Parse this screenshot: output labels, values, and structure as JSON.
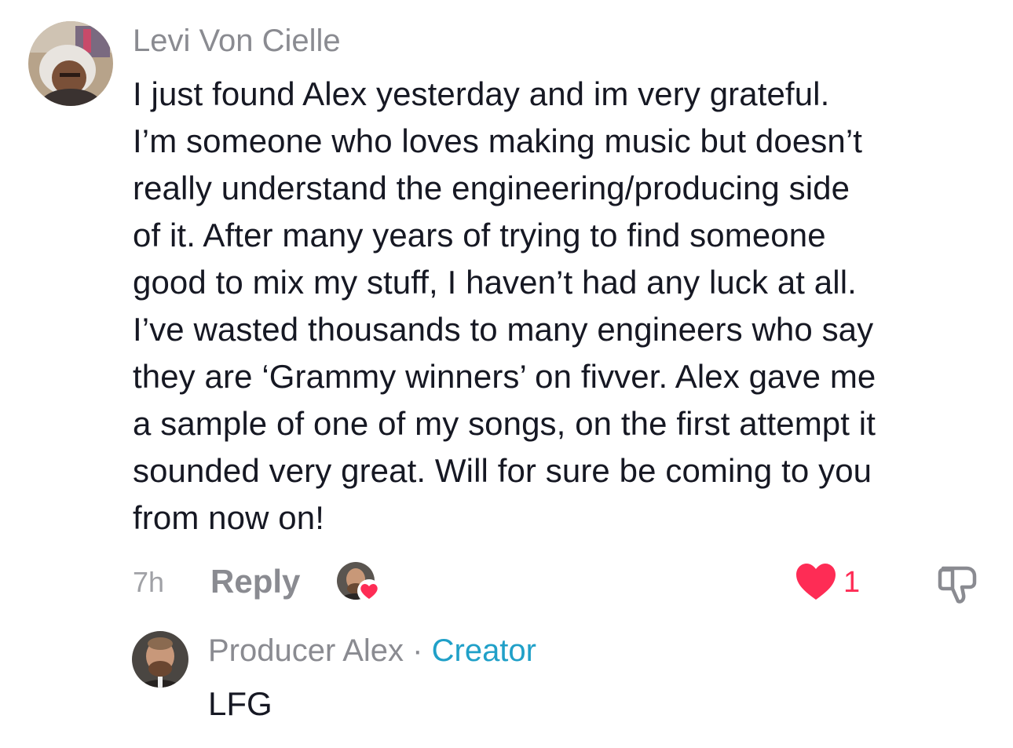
{
  "comment": {
    "username": "Levi Von Cielle",
    "avatar_icon": "user-avatar-photo",
    "lines": [
      "I just found Alex yesterday and im very grateful.",
      "I’m someone who loves making music but doesn’t",
      "really understand the engineering/producing side",
      "of it. After many years of trying to find someone",
      "good to mix my stuff, I haven’t had any luck at all.",
      "I’ve wasted thousands to many engineers who say",
      "they are ‘Grammy winners’ on fivver. Alex gave me",
      "a sample of one of my songs, on the first attempt it",
      "sounded very great. Will for sure be coming to you",
      "from now on!"
    ],
    "time": "7h",
    "reply_label": "Reply",
    "like_count": "1",
    "liked": true,
    "creator_liked": true
  },
  "reply": {
    "username": "Producer Alex",
    "separator": "·",
    "badge": "Creator",
    "text": "LFG",
    "avatar_icon": "creator-avatar-photo"
  },
  "colors": {
    "accent_red": "#fe2c55",
    "creator_blue": "#20a0c8",
    "muted_gray": "#8a8b91"
  }
}
